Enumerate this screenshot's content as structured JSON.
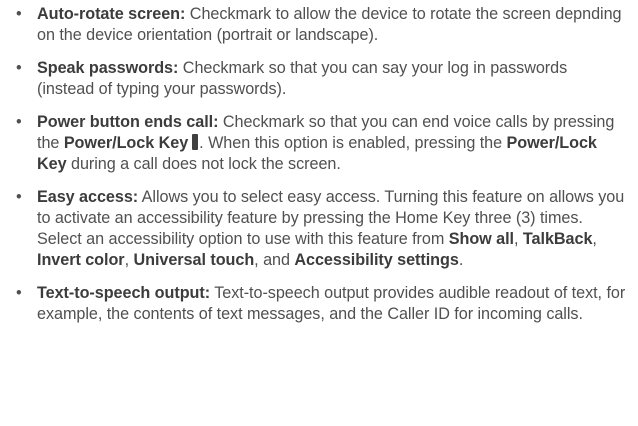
{
  "bullet_char": "•",
  "items": [
    {
      "term": "Auto-rotate screen:",
      "text": " Checkmark to allow the device to rotate the screen depnding on the device orientation (portrait or landscape)."
    },
    {
      "term": "Speak passwords:",
      "text": " Checkmark so that you can say your log in passwords (instead of typing your passwords)."
    },
    {
      "term": "Power button ends call:",
      "text_a": " Checkmark so that you can end voice calls by pressing the ",
      "key_a": "Power/Lock Key",
      "text_b": ". When this option is enabled, pressing the ",
      "key_b": "Power/Lock Key",
      "text_c": " during a call does not lock the screen.",
      "key_icon": "power-lock-key-icon"
    },
    {
      "term": "Easy access:",
      "text_a": " Allows you to select easy access. Turning this feature on allows you to activate an accessibility feature by pressing the Home Key three (3) times. Select an accessibility option to use with this feature from ",
      "opt_1": "Show all",
      "sep_1": ", ",
      "opt_2": "TalkBack",
      "sep_2": ", ",
      "opt_3": "Invert color",
      "sep_3": ", ",
      "opt_4": "Universal touch",
      "sep_4": ", and ",
      "opt_5": "Accessibility settings",
      "text_b": "."
    },
    {
      "term": "Text-to-speech output:",
      "text": " Text-to-speech output provides audible readout of text, for example, the contents of text messages, and the Caller ID for incoming calls."
    }
  ]
}
